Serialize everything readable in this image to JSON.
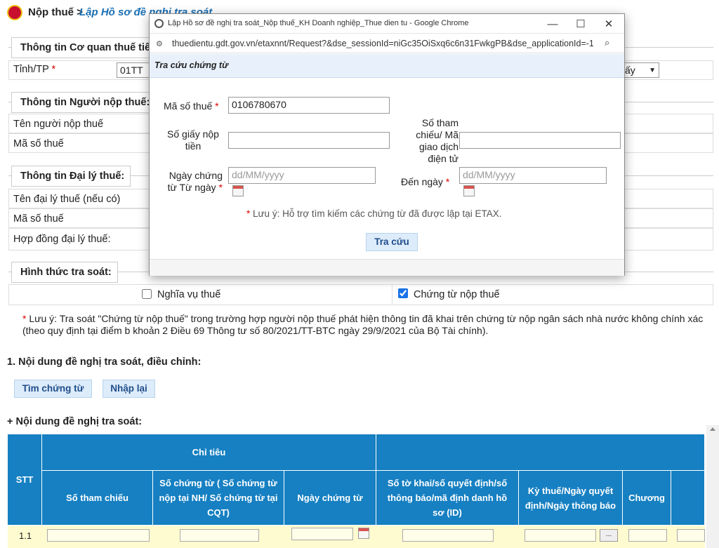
{
  "header": {
    "section": "Nộp thuế >",
    "page": "Lập Hồ sơ đề nghị tra soát"
  },
  "agency": {
    "legend": "Thông tin Cơ quan thuế tiế",
    "province_label": "Tỉnh/TP",
    "province_value": "01TT",
    "select_value": "ấy"
  },
  "taxpayer": {
    "legend": "Thông tin Người nộp thuế:",
    "name_label": "Tên người nộp thuế",
    "tin_label": "Mã số thuế"
  },
  "agent": {
    "legend": "Thông tin Đại lý thuế:",
    "name_label": "Tên đại lý thuế (nếu có)",
    "tin_label": "Mã số thuế",
    "contract_label": "Hợp đồng đại lý thuế:"
  },
  "form_type": {
    "legend": "Hình thức tra soát:",
    "opt1": "Nghĩa vụ thuế",
    "opt1_checked": false,
    "opt2": "Chứng từ nộp thuế",
    "opt2_checked": true
  },
  "note": {
    "star": "*",
    "text": " Lưu ý: Tra soát \"Chứng từ nộp thuế\" trong trường hợp người nộp thuế phát hiện thông tin đã khai trên chứng từ nộp ngân sách nhà nước không chính xác (theo quy định tại điểm b khoản 2 Điều 69 Thông tư số 80/2021/TT-BTC ngày 29/9/2021 của Bộ Tài chính)."
  },
  "section1": {
    "title": "1. Nội dung đề nghị tra soát, điều chỉnh:",
    "btn_search": "Tìm chứng từ",
    "btn_reset": "Nhập lại"
  },
  "content": {
    "title": "+ Nội dung đề nghị tra soát:"
  },
  "table": {
    "h_stt": "STT",
    "h_group": "Chỉ tiêu",
    "h_ref": "Số tham chiếu",
    "h_docno": "Số chứng từ ( Số chứng từ nộp tại NH/ Số chứng từ tại CQT)",
    "h_docdate": "Ngày chứng từ",
    "h_id": "Số tờ khai/số quyết định/số thông báo/mã định danh hồ sơ (ID)",
    "h_period": "Kỳ thuế/Ngày quyết định/Ngày thông báo",
    "h_chapter": "Chương",
    "row_stt": "1.1",
    "ellipsis": "..."
  },
  "modal": {
    "window_title": "Lập Hồ sơ đề nghị tra soát_Nộp thuế_KH Doanh nghiệp_Thue dien tu - Google Chrome",
    "url": "thuedientu.gdt.gov.vn/etaxnnt/Request?&dse_sessionId=niGc35OiSxq6c6n31FwkgPB&dse_applicationId=-1&...",
    "heading": "Tra cứu chứng từ",
    "tin_label": "Mã số thuế",
    "tin_value": "0106780670",
    "payslip_label": "Số giấy nộp tiền",
    "ref_label": "Số tham chiếu/ Mã giao dịch điện tử",
    "from_label": "Ngày chứng từ Từ ngày",
    "to_label": "Đến ngày",
    "date_placeholder": "dd/MM/yyyy",
    "hint": "* Lưu ý: Hỗ trợ tìm kiếm các chứng từ đã được lập tại ETAX.",
    "search_btn": "Tra cứu",
    "minimize": "—",
    "maximize": "☐",
    "close": "✕"
  },
  "colors": {
    "accent": "#1680c2",
    "link": "#1a6fb3",
    "required": "#dd0000"
  }
}
